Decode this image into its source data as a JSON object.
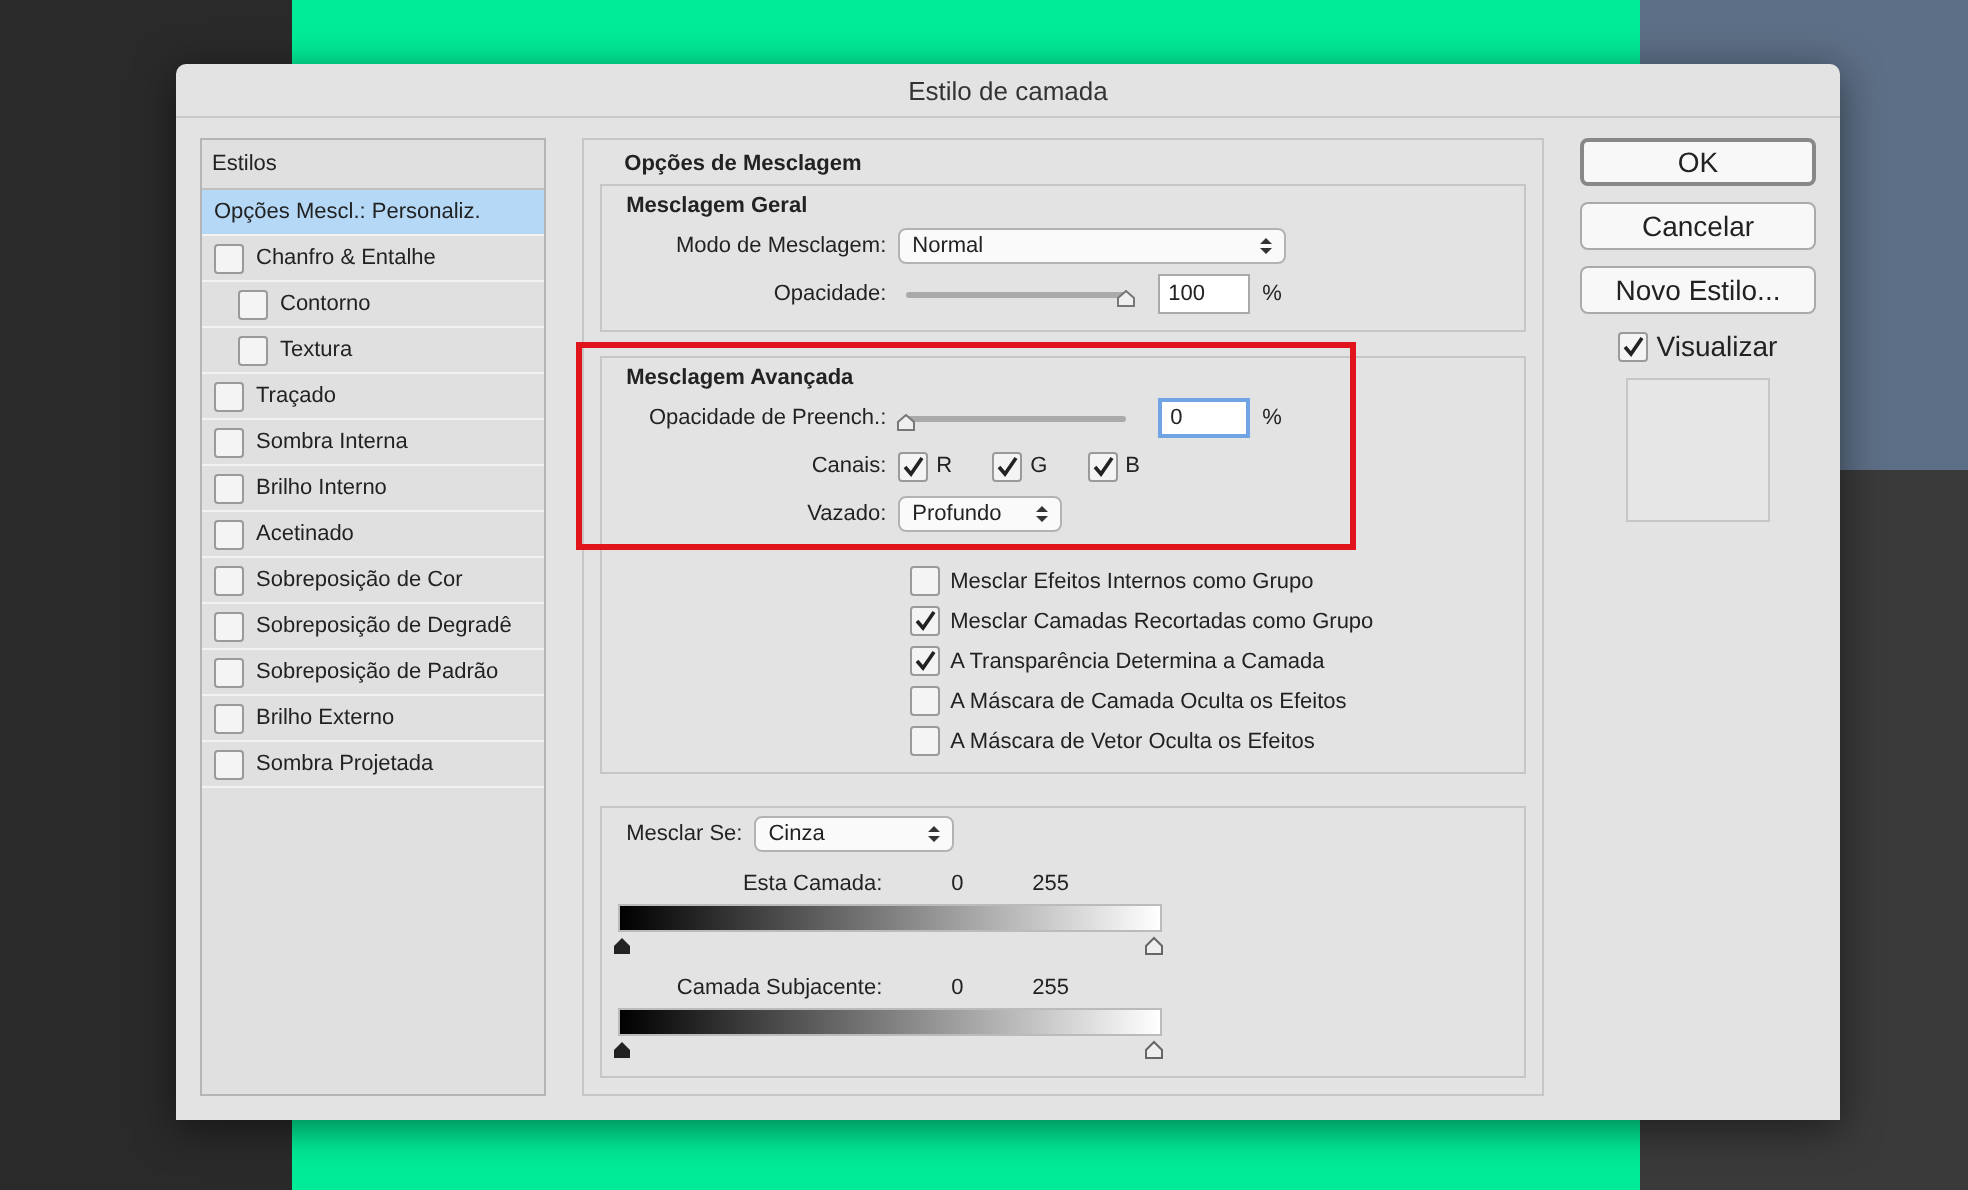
{
  "window": {
    "title": "Estilo de camada"
  },
  "styles": {
    "header": "Estilos",
    "items": [
      {
        "label": "Opções Mescl.: Personaliz.",
        "kind": "option",
        "selected": true
      },
      {
        "label": "Chanfro & Entalhe",
        "kind": "check",
        "checked": false,
        "selected": false,
        "children": [
          {
            "label": "Contorno",
            "kind": "check",
            "checked": false,
            "selected": false
          },
          {
            "label": "Textura",
            "kind": "check",
            "checked": false,
            "selected": false
          }
        ]
      },
      {
        "label": "Traçado",
        "kind": "check",
        "checked": false,
        "selected": false
      },
      {
        "label": "Sombra Interna",
        "kind": "check",
        "checked": false,
        "selected": false
      },
      {
        "label": "Brilho Interno",
        "kind": "check",
        "checked": false,
        "selected": false
      },
      {
        "label": "Acetinado",
        "kind": "check",
        "checked": false,
        "selected": false
      },
      {
        "label": "Sobreposição de Cor",
        "kind": "check",
        "checked": false,
        "selected": false
      },
      {
        "label": "Sobreposição de Degradê",
        "kind": "check",
        "checked": false,
        "selected": false
      },
      {
        "label": "Sobreposição de Padrão",
        "kind": "check",
        "checked": false,
        "selected": false
      },
      {
        "label": "Brilho Externo",
        "kind": "check",
        "checked": false,
        "selected": false
      },
      {
        "label": "Sombra Projetada",
        "kind": "check",
        "checked": false,
        "selected": false
      }
    ]
  },
  "blending": {
    "title": "Opções de Mesclagem",
    "general": {
      "title": "Mesclagem Geral",
      "mode_label": "Modo de Mesclagem:",
      "mode_value": "Normal",
      "opacity_label": "Opacidade:",
      "opacity": {
        "level": 1,
        "value": "100",
        "unit": "%",
        "focused": false
      }
    },
    "advanced": {
      "title": "Mesclagem Avançada",
      "fill_label": "Opacidade de Preench.:",
      "fill": {
        "level": 0,
        "value": "0",
        "unit": "%",
        "focused": true
      },
      "channels_label": "Canais:",
      "channels": [
        {
          "label": "R",
          "checked": true
        },
        {
          "label": "G",
          "checked": true
        },
        {
          "label": "B",
          "checked": true
        }
      ],
      "knockout_label": "Vazado:",
      "knockout_value": "Profundo",
      "options": [
        {
          "label": "Mesclar Efeitos Internos como Grupo",
          "checked": false
        },
        {
          "label": "Mesclar Camadas Recortadas como Grupo",
          "checked": true
        },
        {
          "label": "A Transparência Determina a Camada",
          "checked": true
        },
        {
          "label": "A Máscara de Camada Oculta os Efeitos",
          "checked": false
        },
        {
          "label": "A Máscara de Vetor Oculta os Efeitos",
          "checked": false
        }
      ]
    },
    "blend_if": {
      "label": "Mesclar Se:",
      "value": "Cinza",
      "ranges": [
        {
          "label": "Esta Camada:",
          "min": "0",
          "max": "255"
        },
        {
          "label": "Camada Subjacente:",
          "min": "0",
          "max": "255"
        }
      ]
    }
  },
  "buttons": [
    {
      "label": "OK",
      "default": true
    },
    {
      "label": "Cancelar",
      "default": false
    },
    {
      "label": "Novo Estilo...",
      "default": false
    }
  ],
  "preview": {
    "label": "Visualizar",
    "checked": true
  }
}
